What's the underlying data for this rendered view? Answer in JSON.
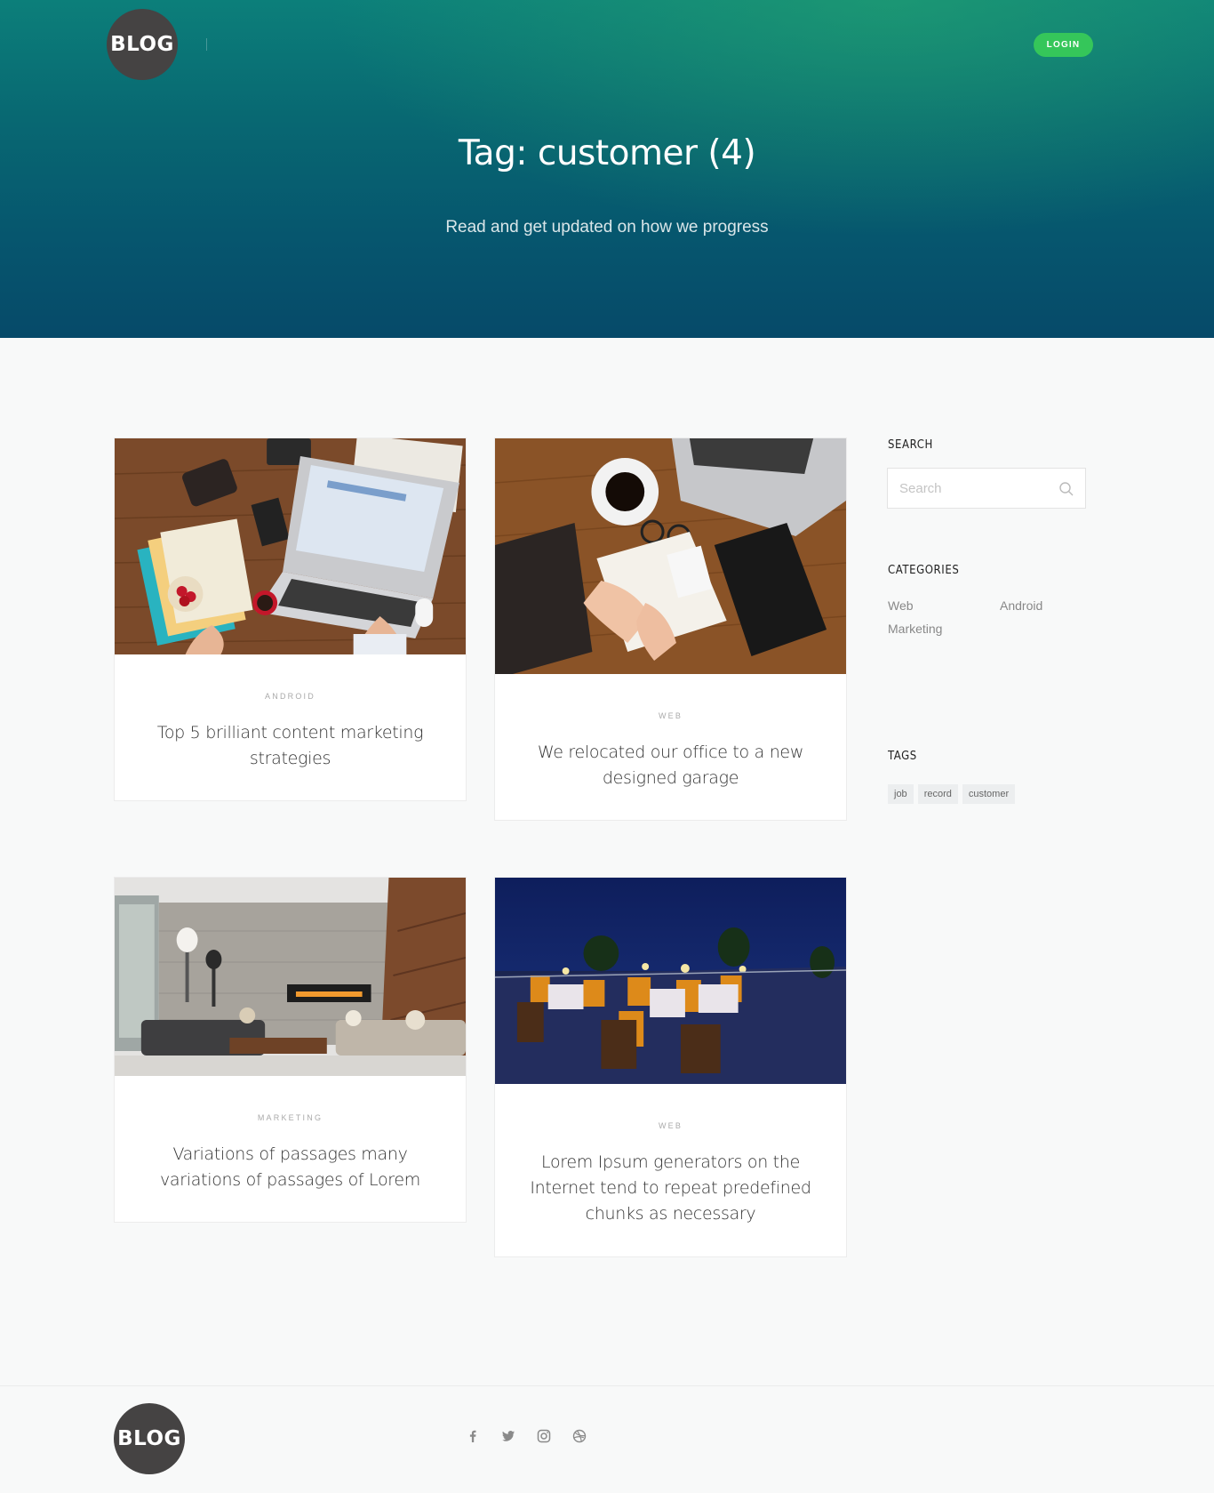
{
  "header": {
    "logo_text": "BLOG",
    "login_label": "LOGIN",
    "title": "Tag: customer (4)",
    "subtitle": "Read and get updated on how we progress"
  },
  "posts": [
    {
      "category": "ANDROID",
      "title": "Top 5 brilliant content marketing strategies",
      "image": "desk-laptop-blog-photo"
    },
    {
      "category": "WEB",
      "title": "We relocated our office to a new designed garage",
      "image": "desk-notebook-coffee-photo"
    },
    {
      "category": "MARKETING",
      "title": "Variations of passages many variations of passages of Lorem",
      "image": "living-room-interior-photo"
    },
    {
      "category": "WEB",
      "title": "Lorem Ipsum generators on the Internet tend to repeat predefined chunks as necessary",
      "image": "rooftop-restaurant-night-photo"
    }
  ],
  "sidebar": {
    "search_heading": "SEARCH",
    "search_placeholder": "Search",
    "categories_heading": "CATEGORIES",
    "categories": [
      "Web",
      "Android",
      "Marketing"
    ],
    "tags_heading": "TAGS",
    "tags": [
      "job",
      "record",
      "customer"
    ]
  },
  "footer": {
    "logo_text": "BLOG",
    "social": [
      "facebook-icon",
      "twitter-icon",
      "instagram-icon",
      "dribbble-icon"
    ]
  },
  "colors": {
    "accent_green": "#35c65a",
    "hero_teal": "#0c7f7a",
    "hero_navy": "#064a69",
    "logo_bg": "#454343"
  }
}
